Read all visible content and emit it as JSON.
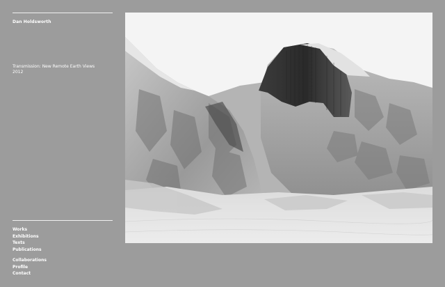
{
  "site": {
    "name": "Dan Holdsworth"
  },
  "work": {
    "title": "Transmission: New Remote Earth Views",
    "year": "2012"
  },
  "nav": {
    "primary": [
      {
        "label": "Works"
      },
      {
        "label": "Exhibitions"
      },
      {
        "label": "Texts"
      },
      {
        "label": "Publications"
      }
    ],
    "secondary": [
      {
        "label": "Collaborations"
      },
      {
        "label": "Profile"
      },
      {
        "label": "Contact"
      }
    ]
  },
  "image": {
    "subject": "grayscale rendering of a mountain landscape with sheer granite cliff",
    "icon": "landscape-image"
  },
  "colors": {
    "background": "#9c9c9c",
    "text": "#ffffff",
    "sky": "#f4f4f4"
  }
}
